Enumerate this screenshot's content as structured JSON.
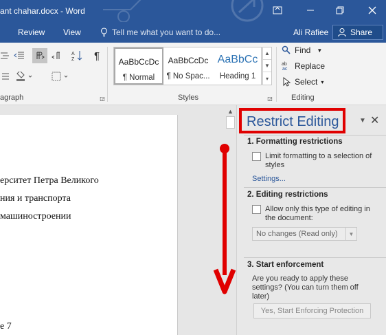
{
  "window": {
    "title": "ant chahar.docx - Word"
  },
  "tabs": [
    "Review",
    "View"
  ],
  "tell_me": "Tell me what you want to do...",
  "user": "Ali Rafiee",
  "share_label": "Share",
  "ribbon": {
    "paragraph_label": "agraph",
    "styles_label": "Styles",
    "editing_label": "Editing",
    "styles": [
      {
        "sample": "AaBbCcDc",
        "name": "¶ Normal"
      },
      {
        "sample": "AaBbCcDc",
        "name": "¶ No Spac..."
      },
      {
        "sample": "AaBbCc",
        "name": "Heading 1"
      }
    ],
    "find_label": "Find",
    "replace_label": "Replace",
    "select_label": "Select"
  },
  "document": {
    "lines": [
      "ерситет Петра Великого",
      "ния и транспорта",
      "машиностроении",
      "е 7"
    ]
  },
  "pane": {
    "title": "Restrict Editing",
    "section1_heading": "1. Formatting restrictions",
    "section1_checkbox": "Limit formatting to a selection of styles",
    "settings_link": "Settings...",
    "section2_heading": "2. Editing restrictions",
    "section2_checkbox": "Allow only this type of editing in the document:",
    "editing_type": "No changes (Read only)",
    "section3_heading": "3. Start enforcement",
    "section3_text": "Are you ready to apply these settings? (You can turn them off later)",
    "enforce_button": "Yes, Start Enforcing Protection"
  },
  "colors": {
    "word_blue": "#2b579a",
    "annotation_red": "#e00000"
  }
}
